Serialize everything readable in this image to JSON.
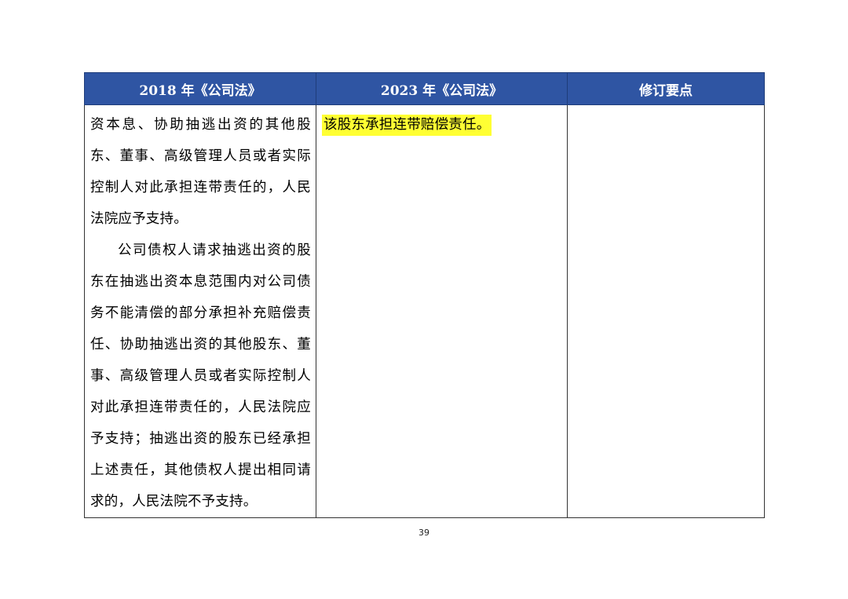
{
  "table": {
    "headers": [
      "2018 年《公司法》",
      "2023 年《公司法》",
      "修订要点"
    ],
    "col_2018": {
      "paragraph1": "资本息、协助抽逃出资的其他股东、董事、高级管理人员或者实际控制人对此承担连带责任的，人民法院应予支持。",
      "paragraph2": "公司债权人请求抽逃出资的股东在抽逃出资本息范围内对公司债务不能清偿的部分承担补充赔偿责任、协助抽逃出资的其他股东、董事、高级管理人员或者实际控制人对此承担连带责任的，人民法院应予支持；抽逃出资的股东已经承担上述责任，其他债权人提出相同请求的，人民法院不予支持。"
    },
    "col_2023": {
      "highlighted_text": "该股东承担连带赔偿责任。"
    },
    "col_notes": {
      "text": ""
    }
  },
  "footer": {
    "page_number": "39"
  },
  "colors": {
    "header_bg": "#2f55a3",
    "header_text": "#ffffff",
    "highlight": "#ffff33"
  }
}
